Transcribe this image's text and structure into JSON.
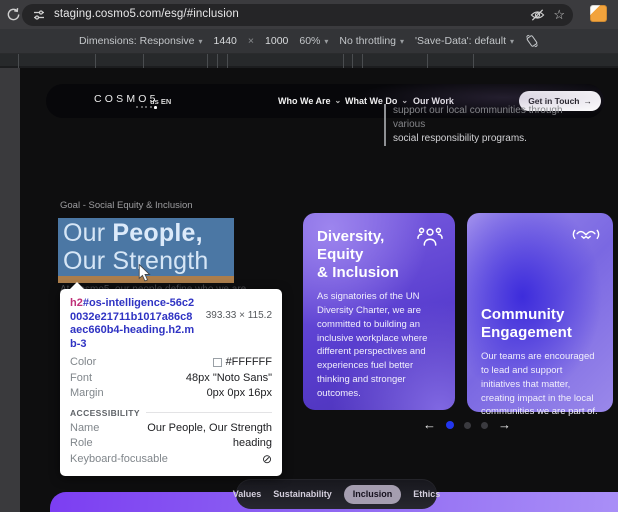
{
  "browser": {
    "url": "staging.cosmo5.com/esg/#inclusion"
  },
  "devtools": {
    "dimensions_label": "Dimensions: Responsive",
    "width": "1440",
    "times": "×",
    "height": "1000",
    "zoom_level": "60%",
    "throttling": "No throttling",
    "save_data": "'Save-Data': default"
  },
  "site": {
    "logo": "COSMO5",
    "locale": "us EN",
    "nav": [
      "Who We Are",
      "What We Do",
      "Our Work"
    ],
    "cta_label": "Get in Touch",
    "cta_arrow": "→",
    "intro_lines": [
      "support our local communities through various",
      "social responsibility programs."
    ],
    "goal_label": "Goal - Social Equity & Inclusion",
    "heading": {
      "pre": "Our ",
      "bold": "People,",
      "line2": "Our Strength",
      "full": "Our People, Our Strength"
    },
    "obscured_text": "At Cosmo5, our people define who we are",
    "cards": [
      {
        "icon": "people-group-icon",
        "title": "Diversity,\nEquity\n& Inclusion",
        "body": "As signatories of the UN Diversity Charter, we are committed to building an inclusive workplace where different perspectives and experiences fuel better thinking and stronger outcomes."
      },
      {
        "icon": "handshake-icon",
        "title": "Community\nEngagement",
        "body": "Our teams are encouraged to lead and support initiatives that matter, creating impact in the local communities we are part of."
      }
    ],
    "carousel": {
      "prev": "←",
      "next": "→",
      "dot_count": 3,
      "active_dot": 1
    },
    "tabs": {
      "items": [
        "Values",
        "Sustainability",
        "Inclusion",
        "Ethics"
      ],
      "active": "Inclusion"
    }
  },
  "tooltip": {
    "tag": "h2",
    "id_selector": "#os-intelligence-56c20032e21711b1017a86c8aec660b4-heading",
    "class_selector": ".h2.mb-3",
    "dimensions": "393.33 × 115.2",
    "rows": [
      {
        "label": "Color",
        "value": "#FFFFFF"
      },
      {
        "label": "Font",
        "value": "48px \"Noto Sans\""
      },
      {
        "label": "Margin",
        "value": "0px 0px 16px"
      }
    ],
    "section_header": "ACCESSIBILITY",
    "a11y_rows": [
      {
        "label": "Name",
        "value": "Our People, Our Strength"
      },
      {
        "label": "Role",
        "value": "heading"
      },
      {
        "label": "Keyboard-focusable",
        "value": "⊘"
      }
    ]
  },
  "colors": {
    "inspect_highlight_blue": "#4b77a4",
    "inspect_margin_orange": "#ab7d4b",
    "active_dot_blue": "#2236ee",
    "card_purple": "#5a3fd0",
    "card_blue": "#3d2cdc",
    "band_purple": "#7c3ef2",
    "extension_orange": "#f2a33c"
  }
}
